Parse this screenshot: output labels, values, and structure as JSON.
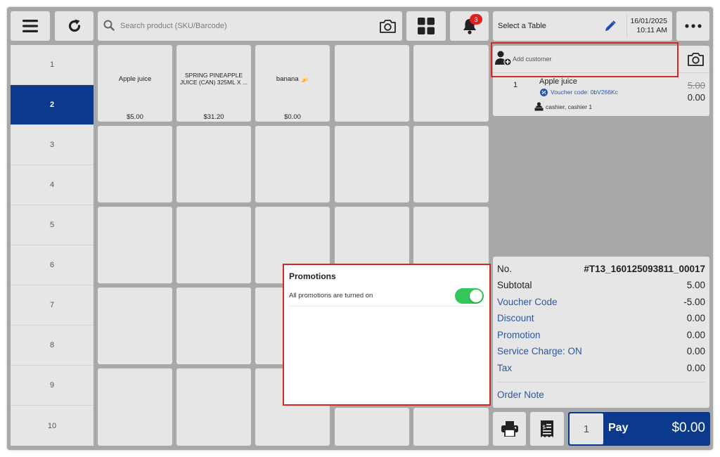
{
  "toolbar": {
    "menu_icon": "hamburger-menu-icon",
    "refresh_icon": "refresh-icon",
    "search_placeholder": "Search product (SKU/Barcode)",
    "notification_count": "3",
    "table_label": "Select a Table",
    "date": "16/01/2025",
    "time": "10:11 AM",
    "more_icon": "ellipsis-icon"
  },
  "categories": [
    "1",
    "2",
    "3",
    "4",
    "5",
    "6",
    "7",
    "8",
    "9",
    "10"
  ],
  "active_category": "2",
  "products": [
    {
      "name": "Apple juice",
      "price": "$5.00"
    },
    {
      "name": "SPRING PINEAPPLE JUICE (CAN) 325ML X ...",
      "price": "$31.20"
    },
    {
      "name": "banana 🍌",
      "price": "$0.00"
    }
  ],
  "customer": {
    "add_label": "Add customer"
  },
  "order": {
    "qty": "1",
    "item_name": "Apple juice",
    "voucher": "Voucher code: 0bV266Kc",
    "staff": "cashier, cashier 1",
    "original_price": "5.00",
    "price": "0.00"
  },
  "summary": {
    "no_label": "No.",
    "no_value": "#T13_160125093811_00017",
    "subtotal_label": "Subtotal",
    "subtotal_value": "5.00",
    "voucher_label": "Voucher Code",
    "voucher_value": "-5.00",
    "discount_label": "Discount",
    "discount_value": "0.00",
    "promotion_label": "Promotion",
    "promotion_value": "0.00",
    "service_label": "Service Charge: ON",
    "service_value": "0.00",
    "tax_label": "Tax",
    "tax_value": "0.00",
    "note_label": "Order Note"
  },
  "promotions_popup": {
    "title": "Promotions",
    "toggle_label": "All promotions are turned on",
    "toggle_on": true
  },
  "footer": {
    "pay_qty": "1",
    "pay_label": "Pay",
    "pay_total": "$0.00"
  },
  "colors": {
    "accent": "#0b3a8c",
    "highlight_border": "#d62626",
    "toggle_on": "#34c759",
    "badge": "#e02020"
  }
}
